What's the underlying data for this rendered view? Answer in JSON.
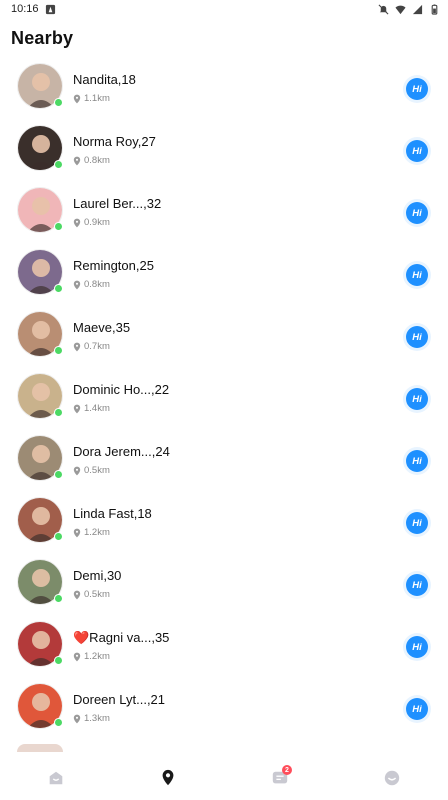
{
  "status_bar": {
    "time": "10:16"
  },
  "header": {
    "title": "Nearby"
  },
  "users": [
    {
      "name": "Nandita,18",
      "distance": "1.1km",
      "online": true,
      "action": "Hi",
      "tone": "#c7b4a6"
    },
    {
      "name": "Norma Roy,27",
      "distance": "0.8km",
      "online": true,
      "action": "Hi",
      "tone": "#3a2f2b"
    },
    {
      "name": "Laurel Ber...,32",
      "distance": "0.9km",
      "online": true,
      "action": "Hi",
      "tone": "#f0b6b8"
    },
    {
      "name": "Remington,25",
      "distance": "0.8km",
      "online": true,
      "action": "Hi",
      "tone": "#7d6a8d"
    },
    {
      "name": "Maeve,35",
      "distance": "0.7km",
      "online": true,
      "action": "Hi",
      "tone": "#b98e73"
    },
    {
      "name": "Dominic Ho...,22",
      "distance": "1.4km",
      "online": true,
      "action": "Hi",
      "tone": "#c9b28c"
    },
    {
      "name": "Dora Jerem...,24",
      "distance": "0.5km",
      "online": true,
      "action": "Hi",
      "tone": "#9c8b74"
    },
    {
      "name": "Linda Fast,18",
      "distance": "1.2km",
      "online": true,
      "action": "Hi",
      "tone": "#a15e4b"
    },
    {
      "name": "Demi,30",
      "distance": "0.5km",
      "online": true,
      "action": "Hi",
      "tone": "#7c8c6a"
    },
    {
      "name": "❤️Ragni va...,35",
      "distance": "1.2km",
      "online": true,
      "action": "Hi",
      "tone": "#b33a3a"
    },
    {
      "name": "Doreen Lyt...,21",
      "distance": "1.3km",
      "online": true,
      "action": "Hi",
      "tone": "#e0573a"
    }
  ],
  "bottom_nav": {
    "items": [
      {
        "name": "home-icon",
        "active": false
      },
      {
        "name": "nearby-location-icon",
        "active": true
      },
      {
        "name": "messages-icon",
        "active": false,
        "badge": "2"
      },
      {
        "name": "profile-icon",
        "active": false
      }
    ]
  },
  "colors": {
    "accent": "#1e90ff",
    "online": "#4cd964",
    "badge": "#ff4d5a"
  }
}
